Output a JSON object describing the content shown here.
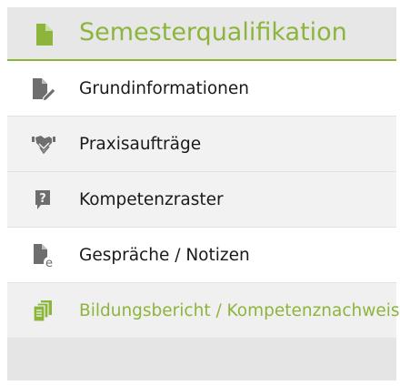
{
  "header": {
    "title": "Semesterqualifikation",
    "icon": "document-icon"
  },
  "menu": {
    "items": [
      {
        "label": "Grundinformationen",
        "icon": "document-edit-icon"
      },
      {
        "label": "Praxisaufträge",
        "icon": "handshake-icon"
      },
      {
        "label": "Kompetenzraster",
        "icon": "question-bubble-icon"
      },
      {
        "label": "Gespräche / Notizen",
        "icon": "document-note-icon"
      },
      {
        "label": "Bildungsbericht / Kompetenznachweis",
        "icon": "documents-stack-icon"
      }
    ],
    "active_index": 4
  },
  "colors": {
    "accent": "#8db53c",
    "icon_grey": "#6e6e6e",
    "text": "#1a1a1a"
  }
}
